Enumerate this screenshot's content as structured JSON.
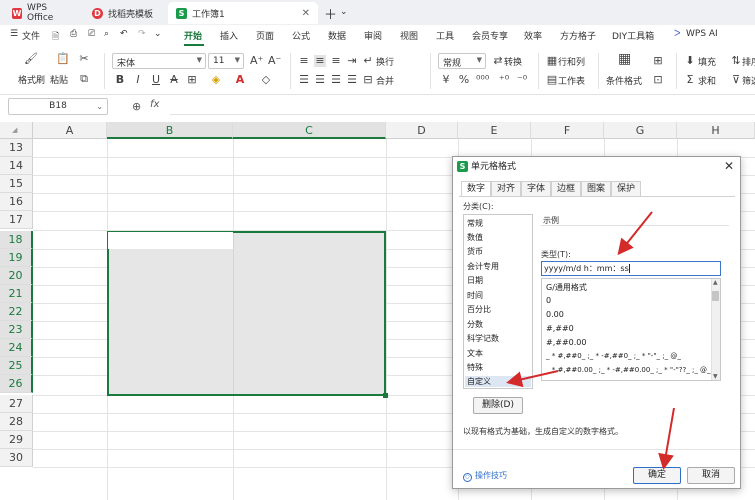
{
  "tabs": [
    {
      "label": "WPS Office"
    },
    {
      "label": "找稻壳模板"
    },
    {
      "label": "工作簿1"
    }
  ],
  "menu": [
    "文件",
    "开始",
    "插入",
    "页面",
    "公式",
    "数据",
    "审阅",
    "视图",
    "工具",
    "会员专享",
    "效率",
    "方方格子",
    "DIY工具箱",
    "WPS AI"
  ],
  "ribbon": {
    "format_brush": "格式刷",
    "paste": "粘贴",
    "font_name": "宋体",
    "font_size": "11",
    "number_format": "常规",
    "wrap": "换行",
    "merge": "合并",
    "convert": "转换",
    "row_col": "行和列",
    "worksheet": "工作表",
    "cond_format": "条件格式",
    "fill": "填充",
    "sum": "求和",
    "sort": "排序",
    "filter": "筛选"
  },
  "namebox": "B18",
  "fx": "fx",
  "columns": [
    "A",
    "B",
    "C",
    "D",
    "E",
    "F",
    "G",
    "H"
  ],
  "rows": [
    "13",
    "14",
    "15",
    "16",
    "17",
    "18",
    "19",
    "20",
    "21",
    "22",
    "23",
    "24",
    "25",
    "26",
    "27",
    "28",
    "29",
    "30"
  ],
  "dialog": {
    "title": "单元格格式",
    "tabs": [
      "数字",
      "对齐",
      "字体",
      "边框",
      "图案",
      "保护"
    ],
    "category_label": "分类(C):",
    "categories": [
      "常规",
      "数值",
      "货币",
      "会计专用",
      "日期",
      "时间",
      "百分比",
      "分数",
      "科学记数",
      "文本",
      "特殊",
      "自定义"
    ],
    "sample_label": "示例",
    "type_label": "类型(T):",
    "type_value": "yyyy/m/d h：mm：ss",
    "formats": [
      "G/通用格式",
      "0",
      "0.00",
      "#,##0",
      "#,##0.00",
      "_ * #,##0_ ;_ * -#,##0_ ;_ * \"-\"_ ;_ @_",
      "_ * #,##0.00_ ;_ * -#,##0.00_ ;_ * \"-\"??_ ;_ @_"
    ],
    "delete_button": "删除(D)",
    "hint": "以现有格式为基础，生成自定义的数字格式。",
    "tips": "操作技巧",
    "ok": "确定",
    "cancel": "取消"
  },
  "colors": {
    "accent": "#1a7a3e",
    "arrow": "#d42a2a",
    "link": "#2d6ec9"
  }
}
